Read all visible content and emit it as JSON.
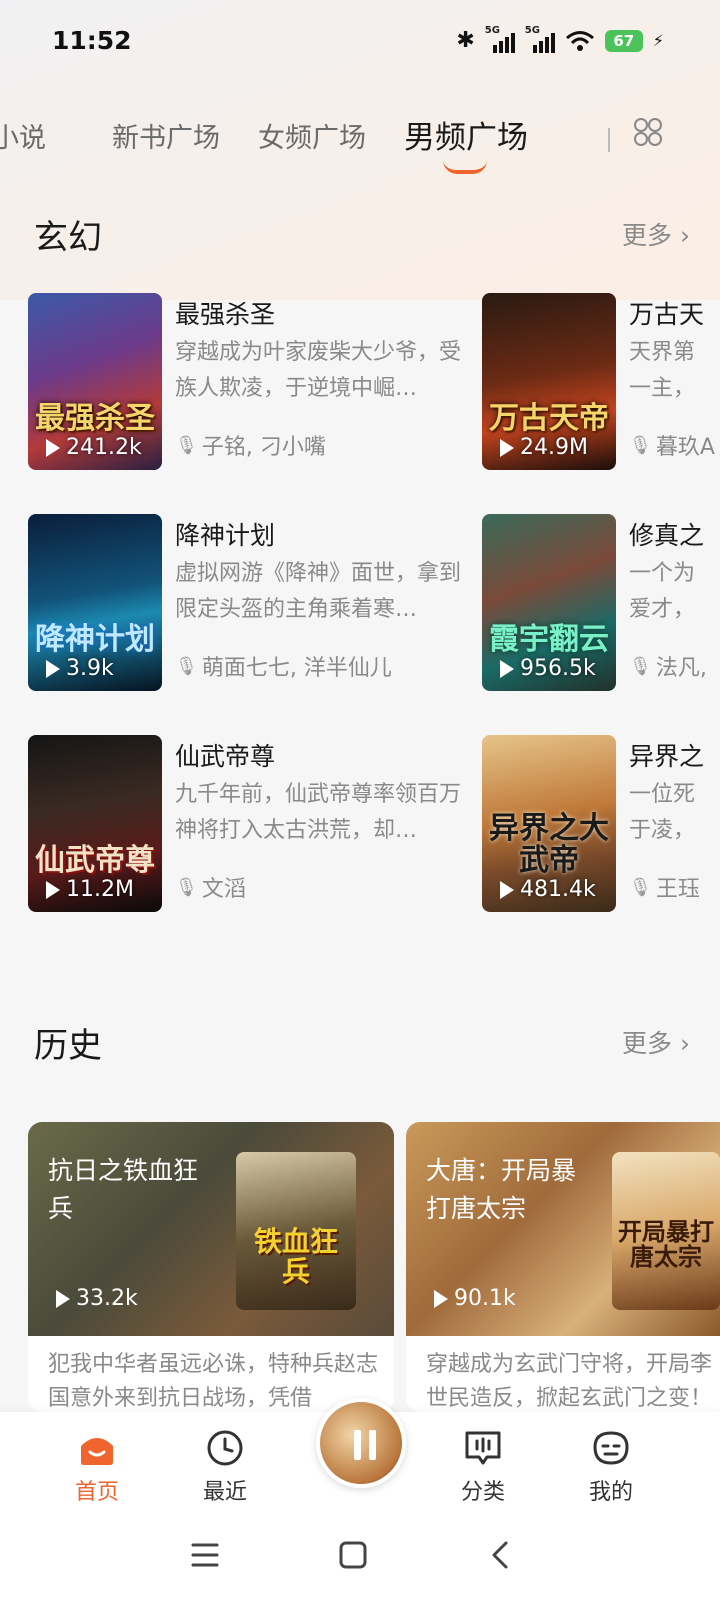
{
  "status": {
    "time": "11:52",
    "battery": "67",
    "net1": "5G",
    "net2": "5G"
  },
  "tabs": [
    {
      "label": "小说"
    },
    {
      "label": "新书广场"
    },
    {
      "label": "女频广场"
    },
    {
      "label": "男频广场",
      "active": true
    }
  ],
  "sections": {
    "xuanhuan": {
      "title": "玄幻",
      "more": "更多",
      "books": [
        {
          "title": "最强杀圣",
          "desc": "穿越成为叶家废柴大少爷，受族人欺凌，于逆境中崛…",
          "author": "子铭, 刁小嘴",
          "plays": "241.2k",
          "cover_text": "最强杀圣"
        },
        {
          "title": "万古天",
          "desc": "天界第一主，遭挚",
          "author": "暮玖A",
          "plays": "24.9M",
          "cover_text": "万古天帝"
        },
        {
          "title": "降神计划",
          "desc": "虚拟网游《降神》面世，拿到限定头盔的主角乘着寒…",
          "author": "萌面七七, 洋半仙儿",
          "plays": "3.9k",
          "cover_text": "降神计划"
        },
        {
          "title": "修真之",
          "desc": "一个为爱才，机缘",
          "author": "法凡, ",
          "plays": "956.5k",
          "cover_text": "霞宇翻云"
        },
        {
          "title": "仙武帝尊",
          "desc": "九千年前，仙武帝尊率领百万神将打入太古洪荒，却…",
          "author": "文滔",
          "plays": "11.2M",
          "cover_text": "仙武帝尊"
        },
        {
          "title": "异界之",
          "desc": "一位死于凌，带着",
          "author": "王珏",
          "plays": "481.4k",
          "cover_text": "异界之大武帝"
        }
      ]
    },
    "history": {
      "title": "历史",
      "more": "更多",
      "cards": [
        {
          "title": "抗日之铁血狂兵",
          "plays": "33.2k",
          "desc": "犯我中华者虽远必诛，特种兵赵志国意外来到抗日战场，凭借",
          "cover_text": "铁血狂兵"
        },
        {
          "title": "大唐：开局暴打唐太宗",
          "plays": "90.1k",
          "desc": "穿越成为玄武门守将，开局李世民造反，掀起玄武门之变！",
          "cover_text": "开局暴打唐太宗"
        }
      ]
    }
  },
  "bottom_nav": {
    "home": "首页",
    "recent": "最近",
    "category": "分类",
    "mine": "我的"
  },
  "colors": {
    "accent": "#f0652d"
  }
}
